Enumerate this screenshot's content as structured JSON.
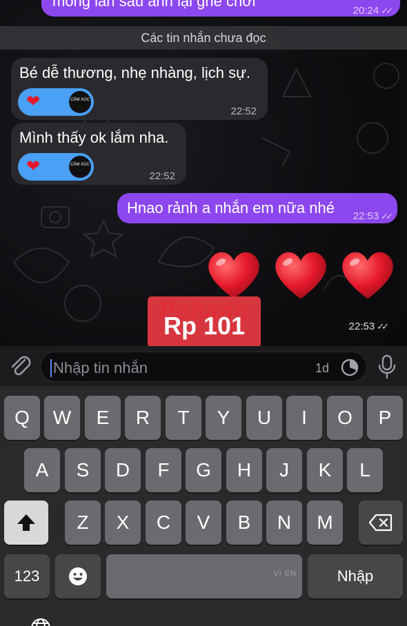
{
  "chat": {
    "top_message": {
      "text": "mong lần sau anh lại ghé chơi",
      "time": "20:24",
      "ticks": "✓✓"
    },
    "unread_divider": "Các tin nhắn chưa đọc",
    "messages": [
      {
        "direction": "in",
        "text": "Bé dễ thương, nhẹ nhàng, lịch sự.",
        "time": "22:52",
        "reaction": {
          "emoji_icon": "red-heart-icon",
          "badge": "CẢM XÚC"
        }
      },
      {
        "direction": "in",
        "text": "Mình thấy ok lắm nha.",
        "time": "22:52",
        "reaction": {
          "emoji_icon": "red-heart-icon",
          "badge": "CẢM XÚC"
        }
      },
      {
        "direction": "out",
        "text": "Hnao rảnh a nhắn em nữa nhé",
        "time": "22:53",
        "ticks": "✓✓"
      }
    ],
    "hearts_message": {
      "count": 3,
      "icon": "red-heart-icon",
      "time": "22:53",
      "ticks": "✓✓"
    },
    "watermark": {
      "logo": "Pohang",
      "label": "Rp 101"
    }
  },
  "composer": {
    "placeholder": "Nhập tin nhắn",
    "timer_label": "1d",
    "attach_icon": "paperclip-icon",
    "timer_icon": "timer-icon",
    "mic_icon": "microphone-icon"
  },
  "keyboard": {
    "row1": [
      "Q",
      "W",
      "E",
      "R",
      "T",
      "Y",
      "U",
      "I",
      "O",
      "P"
    ],
    "row2": [
      "A",
      "S",
      "D",
      "F",
      "G",
      "H",
      "J",
      "K",
      "L"
    ],
    "row3": [
      "Z",
      "X",
      "C",
      "V",
      "B",
      "N",
      "M"
    ],
    "numbers_key": "123",
    "emoji_key_icon": "emoji-icon",
    "shift_icon": "shift-icon",
    "delete_icon": "backspace-icon",
    "return_key": "Nhập",
    "space_hint": "VI EN",
    "globe_icon": "globe-icon"
  },
  "colors": {
    "outgoing_bubble": "#8d47ee",
    "incoming_bubble": "#2a2a2e",
    "reaction": "#4aa0f5",
    "heart": "#e5192b"
  }
}
